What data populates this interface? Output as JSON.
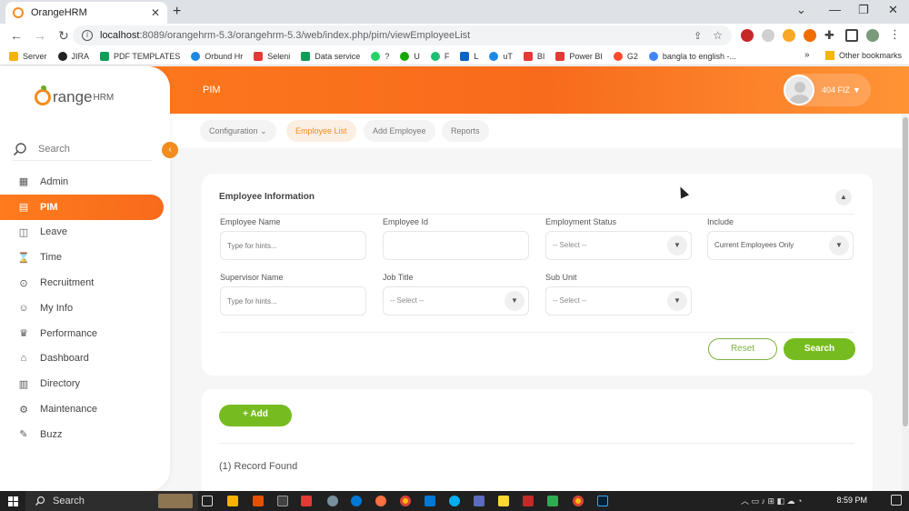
{
  "browser": {
    "tab_title": "OrangeHRM",
    "url_host": "localhost",
    "url_rest": ":8089/orangehrm-5.3/orangehrm-5.3/web/index.php/pim/viewEmployeeList",
    "bookmarks": [
      "Server",
      "JIRA",
      "PDF TEMPLATES",
      "Orbund Hr",
      "Seleni",
      "Data service",
      "?",
      "U",
      "F",
      "L",
      "uT",
      "BI",
      "Power BI",
      "G2",
      "bangla to english -..."
    ],
    "other_bookmarks": "Other bookmarks"
  },
  "colors": {
    "accent": "#ff7b1d",
    "green": "#76bc21"
  },
  "app": {
    "logo_text_prefix": "range",
    "logo_hrm": "HRM",
    "module": "PIM",
    "user_name": "404 FIZ",
    "sidebar_search": "Search",
    "menu": [
      {
        "label": "Admin",
        "icon": "admin-icon"
      },
      {
        "label": "PIM",
        "icon": "pim-icon",
        "active": true
      },
      {
        "label": "Leave",
        "icon": "leave-icon"
      },
      {
        "label": "Time",
        "icon": "time-icon"
      },
      {
        "label": "Recruitment",
        "icon": "recruitment-icon"
      },
      {
        "label": "My Info",
        "icon": "my-info-icon"
      },
      {
        "label": "Performance",
        "icon": "performance-icon"
      },
      {
        "label": "Dashboard",
        "icon": "dashboard-icon"
      },
      {
        "label": "Directory",
        "icon": "directory-icon"
      },
      {
        "label": "Maintenance",
        "icon": "maintenance-icon"
      },
      {
        "label": "Buzz",
        "icon": "buzz-icon"
      }
    ],
    "subnav": {
      "configuration": "Configuration",
      "employee_list": "Employee List",
      "add_employee": "Add Employee",
      "reports": "Reports"
    },
    "filter": {
      "title": "Employee Information",
      "employee_name_label": "Employee Name",
      "employee_name_placeholder": "Type for hints...",
      "employee_id_label": "Employee Id",
      "employment_status_label": "Employment Status",
      "employment_status_value": "-- Select --",
      "include_label": "Include",
      "include_value": "Current Employees Only",
      "supervisor_name_label": "Supervisor Name",
      "supervisor_name_placeholder": "Type for hints...",
      "job_title_label": "Job Title",
      "job_title_value": "-- Select --",
      "sub_unit_label": "Sub Unit",
      "sub_unit_value": "-- Select --",
      "reset": "Reset",
      "search": "Search"
    },
    "list": {
      "add": "+ Add",
      "records": "(1) Record Found"
    }
  },
  "taskbar": {
    "search": "Search",
    "time": "8:59 PM"
  }
}
